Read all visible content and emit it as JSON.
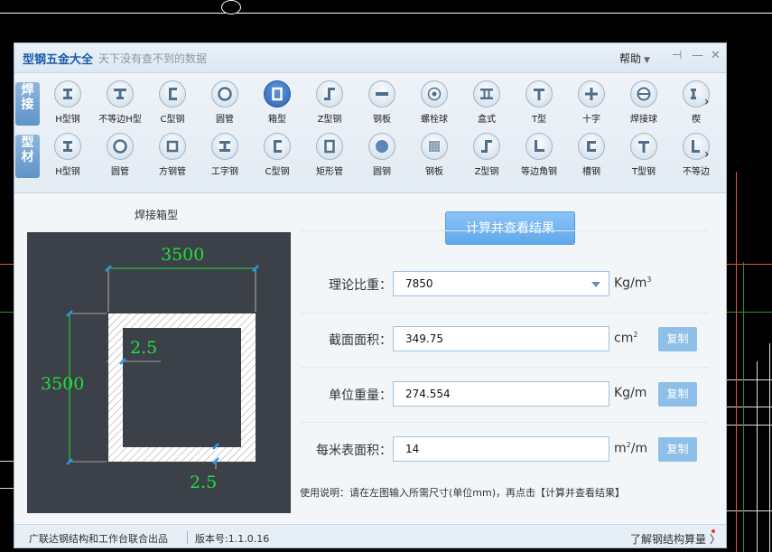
{
  "window": {
    "title": "型钢五金大全",
    "subtitle": "天下没有查不到的数据",
    "help_label": "帮助",
    "help_arrow": "▼",
    "pin_icon": "⊣",
    "min_icon": "—",
    "close_icon": "✕"
  },
  "toolbar": {
    "cat_welding": [
      "焊",
      "接"
    ],
    "cat_profile": [
      "型",
      "材"
    ],
    "welding_items": [
      {
        "label": "H型钢",
        "icon": "h-beam-icon"
      },
      {
        "label": "不等边H型",
        "icon": "unequal-h-icon"
      },
      {
        "label": "C型钢",
        "icon": "c-channel-icon"
      },
      {
        "label": "圆管",
        "icon": "round-tube-icon"
      },
      {
        "label": "箱型",
        "icon": "box-section-icon"
      },
      {
        "label": "Z型钢",
        "icon": "z-section-icon"
      },
      {
        "label": "钢板",
        "icon": "plate-icon"
      },
      {
        "label": "螺栓球",
        "icon": "bolt-ball-icon"
      },
      {
        "label": "盒式",
        "icon": "box-type-icon"
      },
      {
        "label": "T型",
        "icon": "t-section-icon"
      },
      {
        "label": "十字",
        "icon": "cross-section-icon"
      },
      {
        "label": "焊接球",
        "icon": "welded-ball-icon"
      },
      {
        "label": "楔",
        "icon": "wedge-icon"
      }
    ],
    "profile_items": [
      {
        "label": "H型钢",
        "icon": "h-beam-icon"
      },
      {
        "label": "圆管",
        "icon": "round-tube-icon"
      },
      {
        "label": "方钢管",
        "icon": "square-tube-icon"
      },
      {
        "label": "工字钢",
        "icon": "i-beam-icon"
      },
      {
        "label": "C型钢",
        "icon": "c-channel-icon"
      },
      {
        "label": "矩形管",
        "icon": "rect-tube-icon"
      },
      {
        "label": "圆钢",
        "icon": "round-bar-icon"
      },
      {
        "label": "钢板",
        "icon": "plate-icon"
      },
      {
        "label": "Z型钢",
        "icon": "z-section-icon"
      },
      {
        "label": "等边角钢",
        "icon": "equal-angle-icon"
      },
      {
        "label": "槽钢",
        "icon": "channel-icon"
      },
      {
        "label": "T型钢",
        "icon": "t-beam-icon"
      },
      {
        "label": "不等边",
        "icon": "unequal-angle-icon"
      }
    ],
    "arrow": "›"
  },
  "left_panel": {
    "title": "焊接箱型",
    "dim_width": "3500",
    "dim_height": "3500",
    "dim_thk_side": "2.5",
    "dim_thk_bottom": "2.5"
  },
  "calc_button": "计算并查看结果",
  "fields": {
    "density_label": "理论比重：",
    "density_value": "7850",
    "density_unit": "Kg/m",
    "density_unit_sup": "3",
    "area_label": "截面面积：",
    "area_value": "349.75",
    "area_unit": "cm",
    "area_unit_sup": "2",
    "weight_label": "单位重量：",
    "weight_value": "274.554",
    "weight_unit": "Kg/m",
    "surface_label": "每米表面积：",
    "surface_value": "14",
    "surface_unit_a": "m",
    "surface_unit_sup": "2",
    "surface_unit_b": "/m",
    "copy_label": "复制"
  },
  "usage": "使用说明：请在左图输入所需尺寸(单位mm)，再点击【计算并查看结果】",
  "status": {
    "left": "广联达钢结构和工作台联合出品",
    "version": "版本号:1.1.0.16",
    "right": "了解钢结构算量",
    "right_arrow": "〉"
  },
  "colors": {
    "accent": "#2f66b3",
    "dimension": "#22e03a",
    "dim_tick": "#1e9be6",
    "button": "#6fb1ee"
  }
}
